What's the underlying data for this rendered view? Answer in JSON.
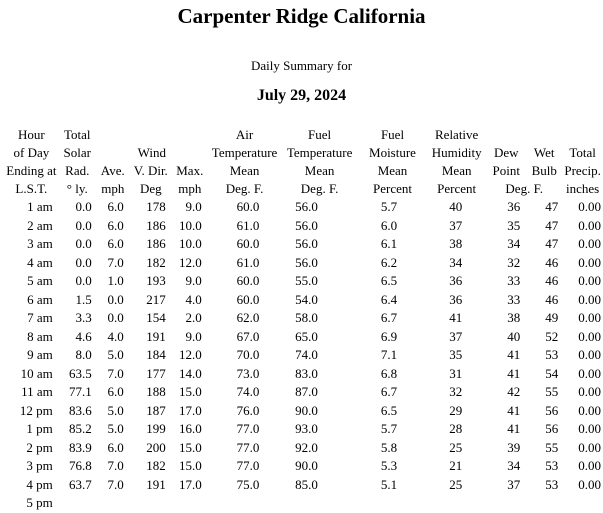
{
  "title": "Carpenter Ridge California",
  "subtitle": "Daily Summary for",
  "date": "July 29, 2024",
  "headers": {
    "hour": [
      "Hour",
      "of Day",
      "Ending at",
      "L.S.T."
    ],
    "solar": [
      "Total",
      "Solar",
      "Rad.",
      "° ly."
    ],
    "wind_group": "Wind",
    "wind_ave": [
      "Ave.",
      "mph"
    ],
    "wind_dir": [
      "V. Dir.",
      "Deg"
    ],
    "wind_max": [
      "Max.",
      "mph"
    ],
    "air_temp": [
      "Air",
      "Temperature",
      "Mean",
      "Deg. F."
    ],
    "fuel_temp": [
      "Fuel",
      "Temperature",
      "Mean",
      "Deg. F."
    ],
    "fuel_moist": [
      "Fuel",
      "Moisture",
      "Mean",
      "Percent"
    ],
    "rh": [
      "Relative",
      "Humidity",
      "Mean",
      "Percent"
    ],
    "dew": [
      "Dew",
      "Point"
    ],
    "wet": [
      "Wet",
      "Bulb"
    ],
    "dew_wet_unit": "Deg. F.",
    "precip": [
      "Total",
      "Precip.",
      "inches"
    ]
  },
  "rows": [
    {
      "hour": "1 am",
      "solar": "0.0",
      "wind_ave": "6.0",
      "wind_dir": "178",
      "wind_max": "9.0",
      "air": "60.0",
      "fuel_temp": "56.0",
      "fuel_moist": "5.7",
      "rh": "40",
      "dew": "36",
      "wet": "47",
      "precip": "0.00"
    },
    {
      "hour": "2 am",
      "solar": "0.0",
      "wind_ave": "6.0",
      "wind_dir": "186",
      "wind_max": "10.0",
      "air": "61.0",
      "fuel_temp": "56.0",
      "fuel_moist": "6.0",
      "rh": "37",
      "dew": "35",
      "wet": "47",
      "precip": "0.00"
    },
    {
      "hour": "3 am",
      "solar": "0.0",
      "wind_ave": "6.0",
      "wind_dir": "186",
      "wind_max": "10.0",
      "air": "60.0",
      "fuel_temp": "56.0",
      "fuel_moist": "6.1",
      "rh": "38",
      "dew": "34",
      "wet": "47",
      "precip": "0.00"
    },
    {
      "hour": "4 am",
      "solar": "0.0",
      "wind_ave": "7.0",
      "wind_dir": "182",
      "wind_max": "12.0",
      "air": "61.0",
      "fuel_temp": "56.0",
      "fuel_moist": "6.2",
      "rh": "34",
      "dew": "32",
      "wet": "46",
      "precip": "0.00"
    },
    {
      "hour": "5 am",
      "solar": "0.0",
      "wind_ave": "1.0",
      "wind_dir": "193",
      "wind_max": "9.0",
      "air": "60.0",
      "fuel_temp": "55.0",
      "fuel_moist": "6.5",
      "rh": "36",
      "dew": "33",
      "wet": "46",
      "precip": "0.00"
    },
    {
      "hour": "6 am",
      "solar": "1.5",
      "wind_ave": "0.0",
      "wind_dir": "217",
      "wind_max": "4.0",
      "air": "60.0",
      "fuel_temp": "54.0",
      "fuel_moist": "6.4",
      "rh": "36",
      "dew": "33",
      "wet": "46",
      "precip": "0.00"
    },
    {
      "hour": "7 am",
      "solar": "3.3",
      "wind_ave": "0.0",
      "wind_dir": "154",
      "wind_max": "2.0",
      "air": "62.0",
      "fuel_temp": "58.0",
      "fuel_moist": "6.7",
      "rh": "41",
      "dew": "38",
      "wet": "49",
      "precip": "0.00"
    },
    {
      "hour": "8 am",
      "solar": "4.6",
      "wind_ave": "4.0",
      "wind_dir": "191",
      "wind_max": "9.0",
      "air": "67.0",
      "fuel_temp": "65.0",
      "fuel_moist": "6.9",
      "rh": "37",
      "dew": "40",
      "wet": "52",
      "precip": "0.00"
    },
    {
      "hour": "9 am",
      "solar": "8.0",
      "wind_ave": "5.0",
      "wind_dir": "184",
      "wind_max": "12.0",
      "air": "70.0",
      "fuel_temp": "74.0",
      "fuel_moist": "7.1",
      "rh": "35",
      "dew": "41",
      "wet": "53",
      "precip": "0.00"
    },
    {
      "hour": "10 am",
      "solar": "63.5",
      "wind_ave": "7.0",
      "wind_dir": "177",
      "wind_max": "14.0",
      "air": "73.0",
      "fuel_temp": "83.0",
      "fuel_moist": "6.8",
      "rh": "31",
      "dew": "41",
      "wet": "54",
      "precip": "0.00"
    },
    {
      "hour": "11 am",
      "solar": "77.1",
      "wind_ave": "6.0",
      "wind_dir": "188",
      "wind_max": "15.0",
      "air": "74.0",
      "fuel_temp": "87.0",
      "fuel_moist": "6.7",
      "rh": "32",
      "dew": "42",
      "wet": "55",
      "precip": "0.00"
    },
    {
      "hour": "12 pm",
      "solar": "83.6",
      "wind_ave": "5.0",
      "wind_dir": "187",
      "wind_max": "17.0",
      "air": "76.0",
      "fuel_temp": "90.0",
      "fuel_moist": "6.5",
      "rh": "29",
      "dew": "41",
      "wet": "56",
      "precip": "0.00"
    },
    {
      "hour": "1 pm",
      "solar": "85.2",
      "wind_ave": "5.0",
      "wind_dir": "199",
      "wind_max": "16.0",
      "air": "77.0",
      "fuel_temp": "93.0",
      "fuel_moist": "5.7",
      "rh": "28",
      "dew": "41",
      "wet": "56",
      "precip": "0.00"
    },
    {
      "hour": "2 pm",
      "solar": "83.9",
      "wind_ave": "6.0",
      "wind_dir": "200",
      "wind_max": "15.0",
      "air": "77.0",
      "fuel_temp": "92.0",
      "fuel_moist": "5.8",
      "rh": "25",
      "dew": "39",
      "wet": "55",
      "precip": "0.00"
    },
    {
      "hour": "3 pm",
      "solar": "76.8",
      "wind_ave": "7.0",
      "wind_dir": "182",
      "wind_max": "15.0",
      "air": "77.0",
      "fuel_temp": "90.0",
      "fuel_moist": "5.3",
      "rh": "21",
      "dew": "34",
      "wet": "53",
      "precip": "0.00"
    },
    {
      "hour": "4 pm",
      "solar": "63.7",
      "wind_ave": "7.0",
      "wind_dir": "191",
      "wind_max": "17.0",
      "air": "75.0",
      "fuel_temp": "85.0",
      "fuel_moist": "5.1",
      "rh": "25",
      "dew": "37",
      "wet": "53",
      "precip": "0.00"
    },
    {
      "hour": "5 pm",
      "solar": "",
      "wind_ave": "",
      "wind_dir": "",
      "wind_max": "",
      "air": "",
      "fuel_temp": "",
      "fuel_moist": "",
      "rh": "",
      "dew": "",
      "wet": "",
      "precip": ""
    }
  ]
}
